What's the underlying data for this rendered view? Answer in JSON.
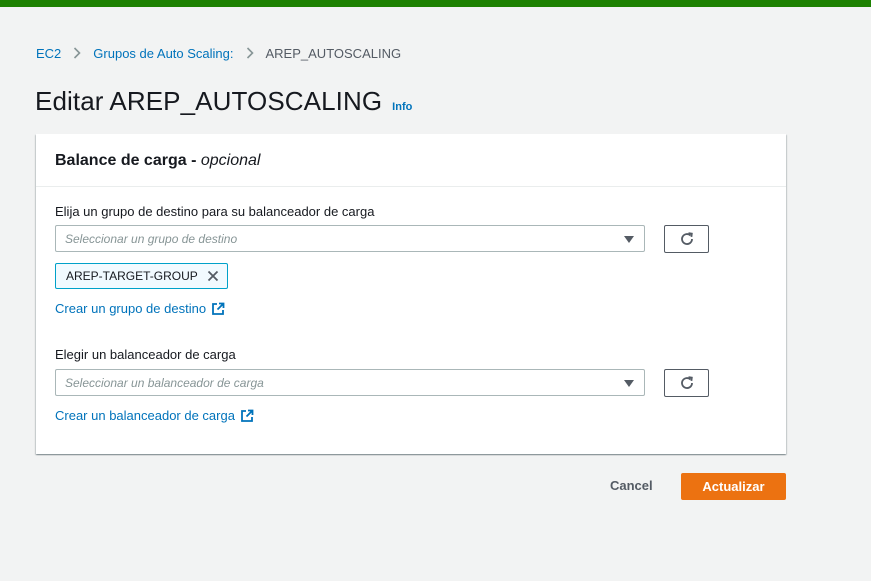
{
  "breadcrumb": {
    "items": [
      "EC2",
      "Grupos de Auto Scaling:"
    ],
    "current": "AREP_AUTOSCALING"
  },
  "page": {
    "title": "Editar AREP_AUTOSCALING",
    "info_link": "Info"
  },
  "panel": {
    "title": "Balance de carga",
    "title_suffix": "opcional",
    "target_group": {
      "label": "Elija un grupo de destino para su balanceador de carga",
      "placeholder": "Seleccionar un grupo de destino",
      "selected_token": "AREP-TARGET-GROUP",
      "create_link": "Crear un grupo de destino"
    },
    "load_balancer": {
      "label": "Elegir un balanceador de carga",
      "placeholder": "Seleccionar un balanceador de carga",
      "create_link": "Crear un balanceador de carga"
    }
  },
  "actions": {
    "cancel": "Cancel",
    "submit": "Actualizar"
  },
  "colors": {
    "top_bar": "#1d8102",
    "link": "#0073bb",
    "primary_button": "#ec7211",
    "token_border": "#00a1c9"
  }
}
